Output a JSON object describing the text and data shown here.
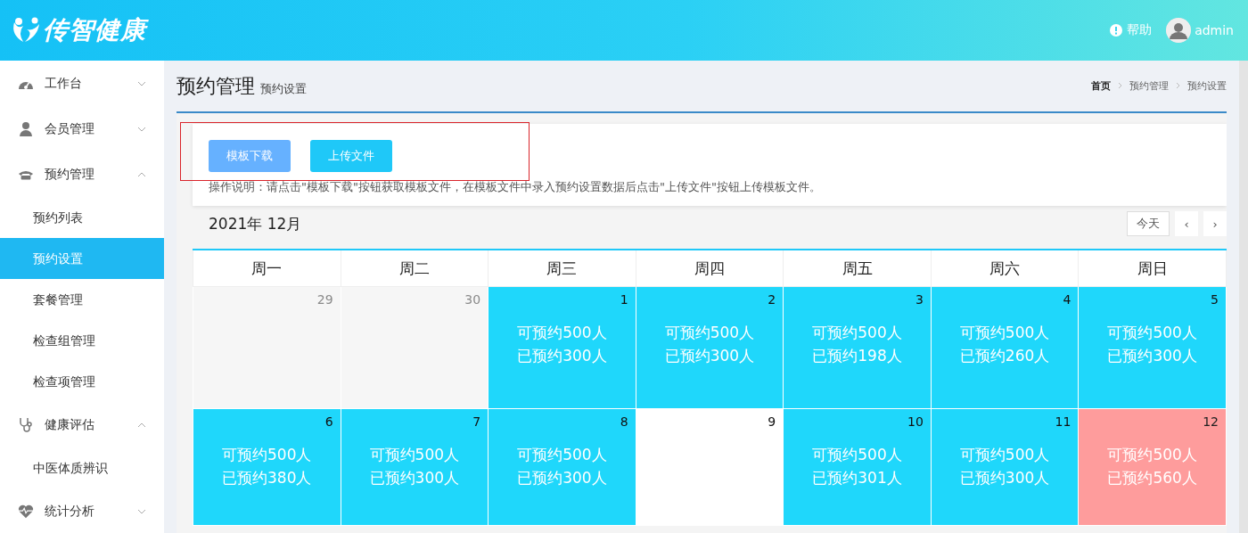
{
  "header": {
    "logo_text": "传智健康",
    "help": "帮助",
    "user": "admin"
  },
  "sidebar": {
    "items": [
      {
        "label": "工作台",
        "expanded": false
      },
      {
        "label": "会员管理",
        "expanded": false
      },
      {
        "label": "预约管理",
        "expanded": true,
        "children": [
          {
            "label": "预约列表",
            "selected": false
          },
          {
            "label": "预约设置",
            "selected": true
          },
          {
            "label": "套餐管理",
            "selected": false
          },
          {
            "label": "检查组管理",
            "selected": false
          },
          {
            "label": "检查项管理",
            "selected": false
          }
        ]
      },
      {
        "label": "健康评估",
        "expanded": true,
        "children": [
          {
            "label": "中医体质辨识",
            "selected": false
          }
        ]
      },
      {
        "label": "统计分析",
        "expanded": false
      }
    ]
  },
  "page": {
    "title": "预约管理",
    "subtitle": "预约设置",
    "breadcrumb": [
      "首页",
      "预约管理",
      "预约设置"
    ]
  },
  "upload_card": {
    "buttons": [
      "模板下载",
      "上传文件"
    ],
    "instructions": "操作说明：请点击\"模板下载\"按钮获取模板文件，在模板文件中录入预约设置数据后点击\"上传文件\"按钮上传模板文件。"
  },
  "calendar": {
    "month": "2021年 12月",
    "today_button": "今天",
    "prev": "‹",
    "next": "›",
    "weekdays": [
      "周一",
      "周二",
      "周三",
      "周四",
      "周五",
      "周六",
      "周日"
    ],
    "days": [
      {
        "day": "29",
        "kind": "other_month"
      },
      {
        "day": "30",
        "kind": "other_month"
      },
      {
        "day": "1",
        "kind": "available",
        "lines": [
          "可预约500人",
          "已预约300人"
        ]
      },
      {
        "day": "2",
        "kind": "available",
        "lines": [
          "可预约500人",
          "已预约300人"
        ]
      },
      {
        "day": "3",
        "kind": "available",
        "lines": [
          "可预约500人",
          "已预约198人"
        ]
      },
      {
        "day": "4",
        "kind": "available",
        "lines": [
          "可预约500人",
          "已预约260人"
        ]
      },
      {
        "day": "5",
        "kind": "available",
        "lines": [
          "可预约500人",
          "已预约300人"
        ]
      },
      {
        "day": "6",
        "kind": "available",
        "lines": [
          "可预约500人",
          "已预约380人"
        ]
      },
      {
        "day": "7",
        "kind": "available",
        "lines": [
          "可预约500人",
          "已预约300人"
        ]
      },
      {
        "day": "8",
        "kind": "available",
        "lines": [
          "可预约500人",
          "已预约300人"
        ]
      },
      {
        "day": "9",
        "kind": "empty"
      },
      {
        "day": "10",
        "kind": "available",
        "lines": [
          "可预约500人",
          "已预约301人"
        ]
      },
      {
        "day": "11",
        "kind": "available",
        "lines": [
          "可预约500人",
          "已预约300人"
        ]
      },
      {
        "day": "12",
        "kind": "full",
        "lines": [
          "可预约500人",
          "已预约560人"
        ]
      }
    ]
  }
}
